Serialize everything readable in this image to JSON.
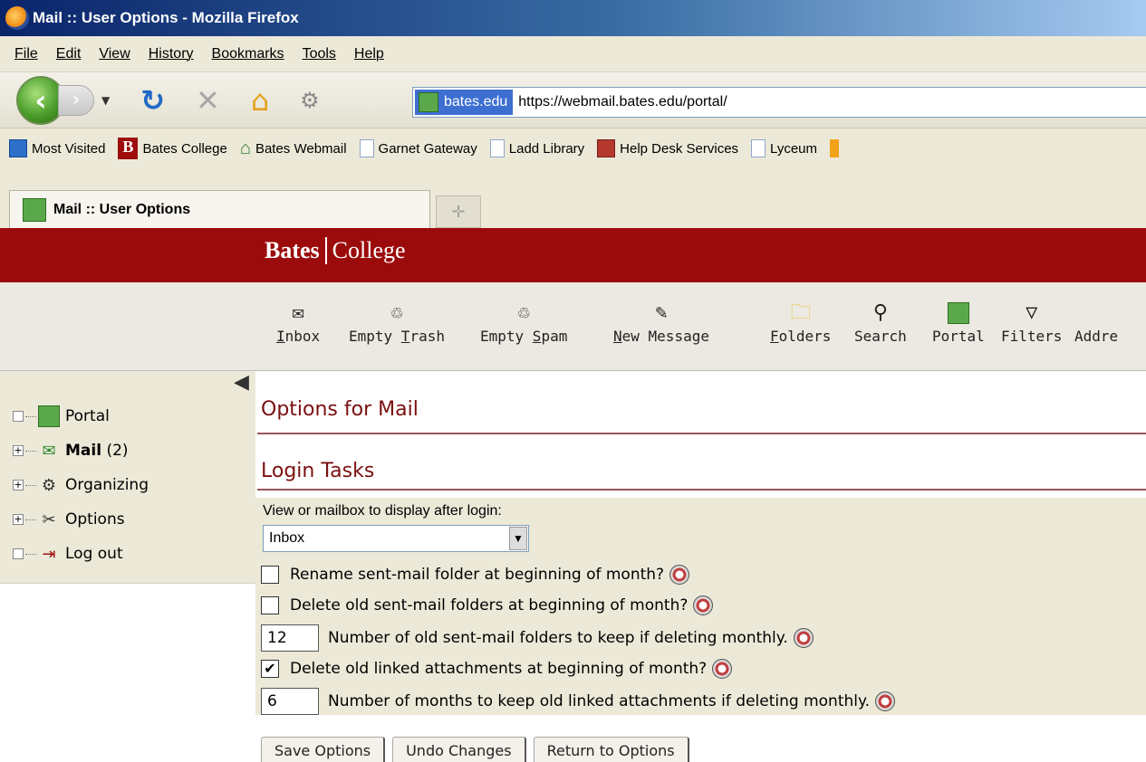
{
  "window": {
    "title": "Mail :: User Options - Mozilla Firefox"
  },
  "menubar": {
    "items": [
      "File",
      "Edit",
      "View",
      "History",
      "Bookmarks",
      "Tools",
      "Help"
    ]
  },
  "navbar": {
    "site_identity": "bates.edu",
    "url": "https://webmail.bates.edu/portal/"
  },
  "bookmarks": {
    "items": [
      "Most Visited",
      "Bates College",
      "Bates Webmail",
      "Garnet Gateway",
      "Ladd Library",
      "Help Desk Services",
      "Lyceum"
    ]
  },
  "tabs": {
    "active": "Mail :: User Options",
    "new_tab_glyph": "✛"
  },
  "brand": {
    "part1": "Bates",
    "part2": "College",
    "color": "#9c0b0b"
  },
  "toolbar": {
    "inbox_pre": "",
    "inbox_ul": "I",
    "inbox_post": "nbox",
    "trash_pre": "Empty ",
    "trash_ul": "T",
    "trash_post": "rash",
    "spam_pre": "Empty ",
    "spam_ul": "S",
    "spam_post": "pam",
    "new_pre": "",
    "new_ul": "N",
    "new_post": "ew Message",
    "folders_pre": "",
    "folders_ul": "F",
    "folders_post": "olders",
    "search": "Search",
    "portal": "Portal",
    "filters": "Filters",
    "address": "Addre"
  },
  "sidebar": {
    "portal": "Portal",
    "mail": "Mail",
    "mail_count": "(2)",
    "organizing": "Organizing",
    "options": "Options",
    "logout": "Log out"
  },
  "main": {
    "title": "Options for Mail",
    "section": "Login Tasks",
    "view_label": "View or mailbox to display after login:",
    "view_value": "Inbox",
    "rename_label": "Rename sent-mail folder at beginning of month?",
    "rename_checked": false,
    "delete_label": "Delete old sent-mail folders at beginning of month?",
    "delete_checked": false,
    "keep_value": "12",
    "keep_label": "Number of old sent-mail folders to keep if deleting monthly.",
    "attach_label": "Delete old linked attachments at beginning of month?",
    "attach_checked": true,
    "months_value": "6",
    "months_label": "Number of months to keep old linked attachments if deleting monthly.",
    "save_button": "Save Options",
    "undo_button": "Undo Changes",
    "return_button": "Return to Options"
  }
}
